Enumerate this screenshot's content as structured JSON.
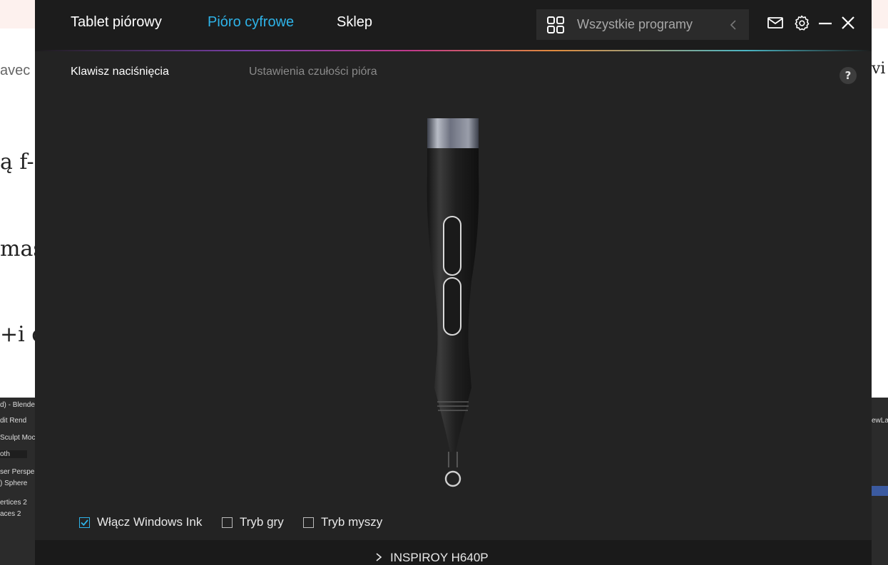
{
  "nav": {
    "tabs": [
      {
        "label": "Tablet piórowy"
      },
      {
        "label": "Pióro cyfrowe"
      },
      {
        "label": "Sklep"
      }
    ],
    "active_tab": "Pióro cyfrowe",
    "programs_label": "Wszystkie programy"
  },
  "subtabs": {
    "keys": "Klawisz naciśnięcia",
    "sensitivity": "Ustawienia czułości pióra"
  },
  "help_label": "?",
  "options": {
    "windows_ink": {
      "label": "Włącz Windows Ink",
      "checked": true
    },
    "game_mode": {
      "label": "Tryb gry",
      "checked": false
    },
    "mouse_mode": {
      "label": "Tryb myszy",
      "checked": false
    }
  },
  "device_name": "INSPIROY H640P",
  "background": {
    "doc_fragments": [
      "avec",
      "ą f-",
      "mas",
      "+i c",
      "vi"
    ],
    "blender_lines": [
      "d) - Blende",
      "dit   Rend",
      "Sculpt Moc",
      "oth",
      "ser Perspe",
      ") Sphere",
      "ertices   2",
      "aces      2"
    ],
    "blender_right": [
      "ewLay"
    ]
  },
  "colors": {
    "accent": "#2eb3e8",
    "app_bg": "#232323",
    "titlebar_bg": "#1c1c1c"
  }
}
